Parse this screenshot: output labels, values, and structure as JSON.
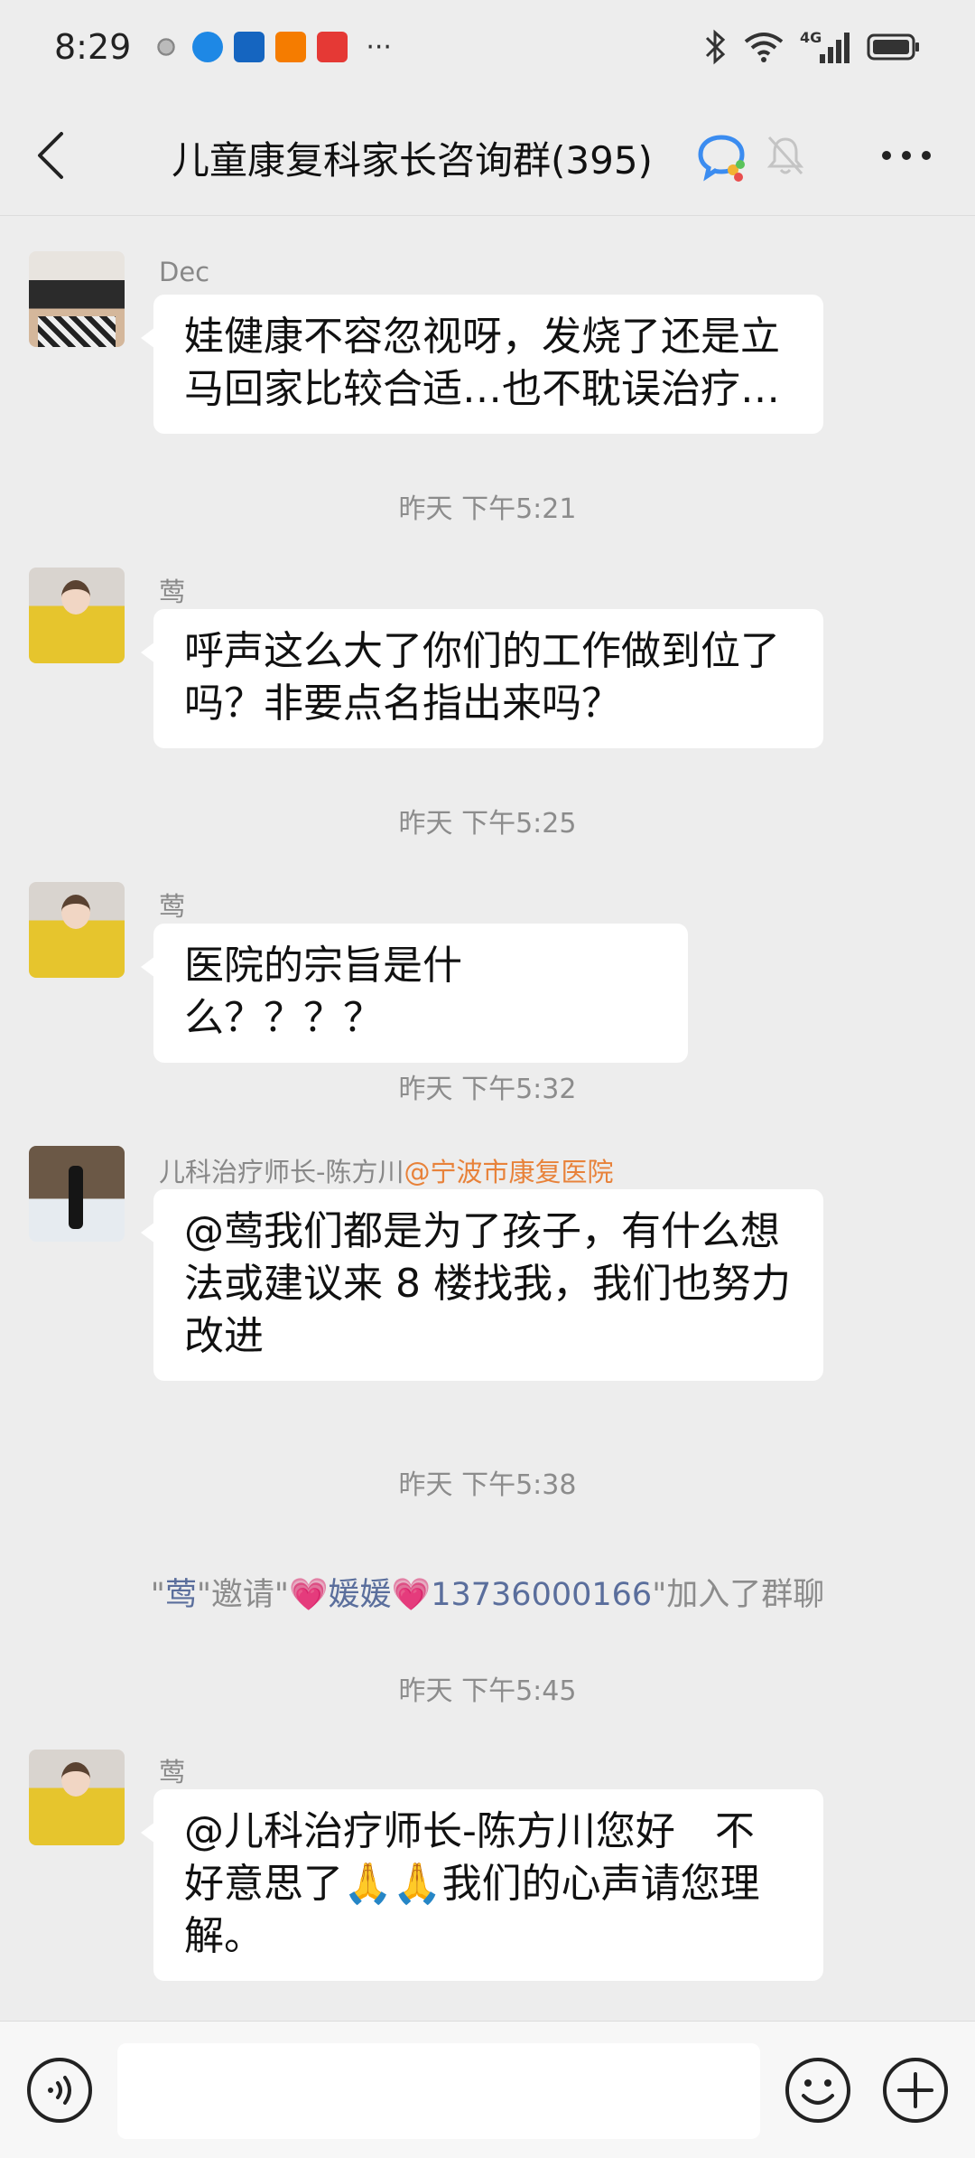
{
  "status_bar": {
    "time": "8:29",
    "dots": "···",
    "network": "4G",
    "app_icons": [
      "app-icon-gray",
      "app-icon-blue",
      "app-icon-news",
      "app-icon-orange",
      "app-icon-red"
    ]
  },
  "header": {
    "title": "儿童康复科家长咨询群(395)",
    "back_icon": "chevron-left-icon",
    "chat_icon": "chat-bubble-icon",
    "mute_icon": "bell-muted-icon",
    "more_icon": "more-dots-icon"
  },
  "messages": [
    {
      "sender": "Dec",
      "lines": [
        "娃健康不容忽视呀，发烧了还是立",
        "马回家比较合适…也不耽误治疗…"
      ]
    },
    {
      "timestamp": "昨天 下午5:21"
    },
    {
      "sender": "莺",
      "lines": [
        "呼声这么大了你们的工作做到位了",
        "吗？非要点名指出来吗？"
      ]
    },
    {
      "timestamp": "昨天 下午5:25"
    },
    {
      "sender": "莺",
      "lines": [
        "医院的宗旨是什么？？？？"
      ]
    },
    {
      "timestamp": "昨天 下午5:32"
    },
    {
      "sender": "儿科治疗师长-陈方川",
      "sender_org": "@宁波市康复医院",
      "lines": [
        "@莺我们都是为了孩子，有什么想",
        "法或建议来 8 楼找我，我们也努力",
        "改进"
      ]
    },
    {
      "timestamp": "昨天 下午5:38"
    },
    {
      "system": {
        "q1": "\"",
        "inviter": "莺",
        "mid": "\"邀请\"",
        "heart1": "💗",
        "invitee_name": "媛媛",
        "heart2": "💗",
        "invitee_number": "13736000166",
        "tail": "\"加入了群聊"
      }
    },
    {
      "timestamp": "昨天 下午5:45"
    },
    {
      "sender": "莺",
      "lines": [
        "@儿科治疗师长-陈方川您好　不",
        "好意思了🙏🙏我们的心声请您理",
        "解。"
      ]
    }
  ],
  "bottom_bar": {
    "input_value": "",
    "voice_icon": "voice-icon",
    "emoji_icon": "emoji-icon",
    "plus_icon": "plus-icon"
  },
  "colors": {
    "background": "#ededed",
    "bubble": "#ffffff",
    "org_tag": "#e8823a",
    "system_name": "#5a6e9c"
  }
}
